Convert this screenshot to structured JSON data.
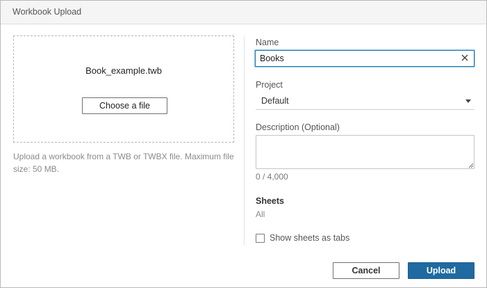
{
  "dialog": {
    "title": "Workbook Upload"
  },
  "upload": {
    "file_name": "Book_example.twb",
    "choose_label": "Choose a file",
    "help_text": "Upload a workbook from a TWB or TWBX file. Maximum file size: 50 MB."
  },
  "form": {
    "name_label": "Name",
    "name_value": "Books",
    "project_label": "Project",
    "project_value": "Default",
    "description_label": "Description (Optional)",
    "description_value": "",
    "char_count": "0 / 4,000",
    "sheets_heading": "Sheets",
    "sheets_value": "All",
    "show_tabs_label": "Show sheets as tabs",
    "show_tabs_checked": false
  },
  "footer": {
    "cancel_label": "Cancel",
    "upload_label": "Upload"
  },
  "colors": {
    "primary": "#1f6aa1",
    "focus_border": "#1f77b4"
  },
  "icons": {
    "clear": "close-icon",
    "dropdown": "caret-down-icon",
    "resize": "resize-grip-icon"
  }
}
